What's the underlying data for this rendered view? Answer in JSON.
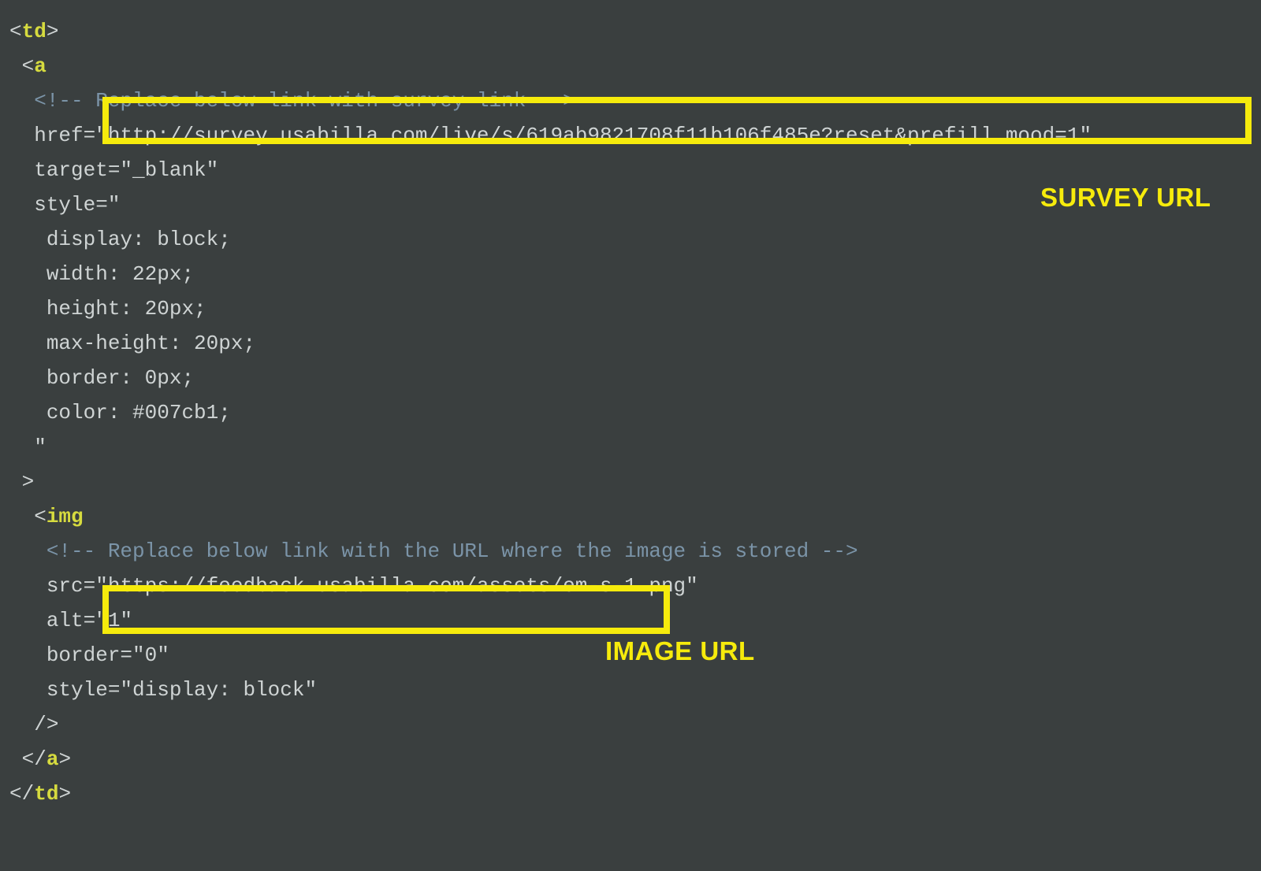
{
  "code": {
    "tag_td": "td",
    "tag_a": "a",
    "tag_img": "img",
    "comment1": "<!-- Replace below link with survey link -->",
    "href_key": "href=",
    "href_q1": "\"",
    "href_val": "http://survey.usabilla.com/live/s/619ab9821708f11b106f485e?reset&prefill_mood=1",
    "href_q2": "\"",
    "target_line": "target=\"_blank\"",
    "style_open": "style=\"",
    "style_display": "display: block;",
    "style_width": "width: 22px;",
    "style_height": "height: 20px;",
    "style_maxheight": "max-height: 20px;",
    "style_border": "border: 0px;",
    "style_color": "color: #007cb1;",
    "style_closeq": "\"",
    "gt": ">",
    "comment2": "<!-- Replace below link with the URL where the image is stored -->",
    "src_key": "src=",
    "src_q1": "\"",
    "src_val": "https://feedback.usabilla.com/assets/em-s-1.png",
    "src_q2": "\"",
    "alt_line": "alt=\"1\"",
    "border_line": "border=\"0\"",
    "style_img": "style=\"display: block\"",
    "selfclose": "/>",
    "close_a_open": "</",
    "close_a_tag": "a",
    "close_a_gt": ">",
    "close_td_open": "</",
    "close_td_tag": "td",
    "close_td_gt": ">"
  },
  "labels": {
    "survey": "SURVEY URL",
    "image": "IMAGE URL"
  }
}
